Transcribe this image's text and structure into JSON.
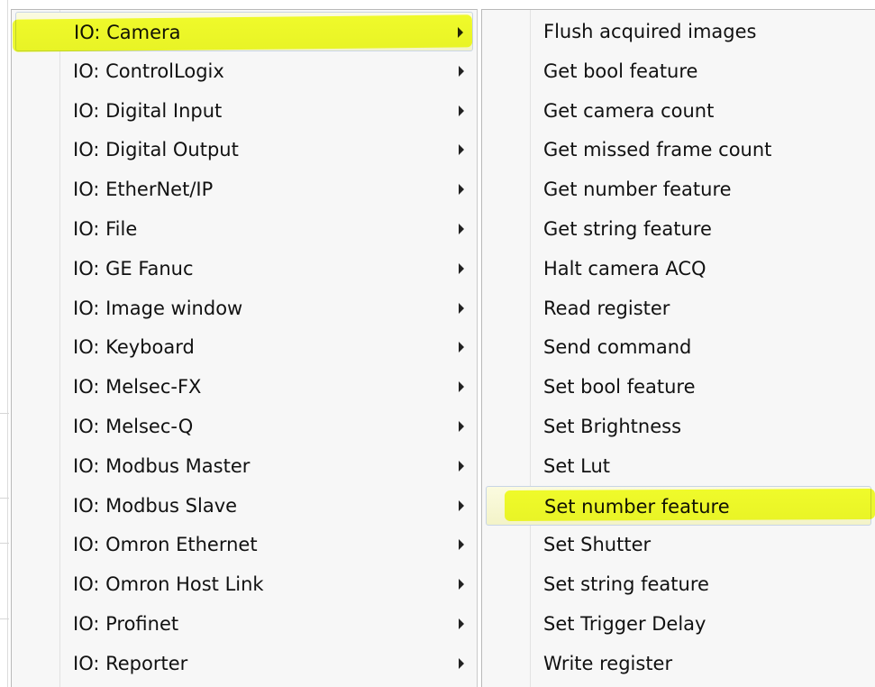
{
  "menus": {
    "left": {
      "items": [
        {
          "label": "IO: Camera",
          "has_submenu": true
        },
        {
          "label": "IO: ControlLogix",
          "has_submenu": true
        },
        {
          "label": "IO: Digital Input",
          "has_submenu": true
        },
        {
          "label": "IO: Digital Output",
          "has_submenu": true
        },
        {
          "label": "IO: EtherNet/IP",
          "has_submenu": true
        },
        {
          "label": "IO: File",
          "has_submenu": true
        },
        {
          "label": "IO: GE Fanuc",
          "has_submenu": true
        },
        {
          "label": "IO: Image window",
          "has_submenu": true
        },
        {
          "label": "IO: Keyboard",
          "has_submenu": true
        },
        {
          "label": "IO: Melsec-FX",
          "has_submenu": true
        },
        {
          "label": "IO: Melsec-Q",
          "has_submenu": true
        },
        {
          "label": "IO: Modbus Master",
          "has_submenu": true
        },
        {
          "label": "IO: Modbus Slave",
          "has_submenu": true
        },
        {
          "label": "IO: Omron Ethernet",
          "has_submenu": true
        },
        {
          "label": "IO: Omron Host Link",
          "has_submenu": true
        },
        {
          "label": "IO: Profinet",
          "has_submenu": true
        },
        {
          "label": "IO: Reporter",
          "has_submenu": true
        }
      ],
      "selected_index": 0
    },
    "right": {
      "items": [
        {
          "label": "Flush acquired images"
        },
        {
          "label": "Get bool feature"
        },
        {
          "label": "Get camera count"
        },
        {
          "label": "Get missed frame count"
        },
        {
          "label": "Get number feature"
        },
        {
          "label": "Get string feature"
        },
        {
          "label": "Halt camera ACQ"
        },
        {
          "label": "Read register"
        },
        {
          "label": "Send command"
        },
        {
          "label": "Set bool feature"
        },
        {
          "label": "Set Brightness"
        },
        {
          "label": "Set Lut"
        },
        {
          "label": "Set number feature"
        },
        {
          "label": "Set Shutter"
        },
        {
          "label": "Set string feature"
        },
        {
          "label": "Set Trigger Delay"
        },
        {
          "label": "Write register"
        }
      ],
      "selected_index": 12
    }
  },
  "colors": {
    "highlight": "#f4ff1e",
    "menu_bg": "#f7f7f7",
    "text": "#111111"
  },
  "icons": {
    "submenu_arrow": "triangle-right-icon"
  }
}
